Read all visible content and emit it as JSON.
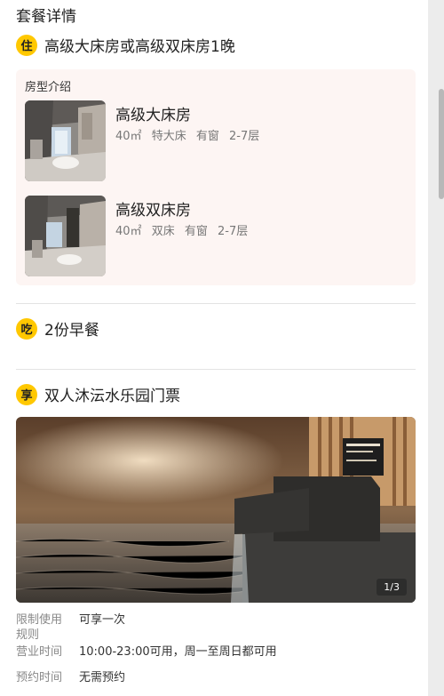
{
  "page": {
    "title": "套餐详情"
  },
  "lodging": {
    "badge": "住",
    "title": "高级大床房或高级双床房1晚",
    "room_type_label": "房型介绍",
    "rooms": [
      {
        "name": "高级大床房",
        "area": "40㎡",
        "bed": "特大床",
        "window": "有窗",
        "floor": "2-7层"
      },
      {
        "name": "高级双床房",
        "area": "40㎡",
        "bed": "双床",
        "window": "有窗",
        "floor": "2-7层"
      }
    ]
  },
  "meal": {
    "badge": "吃",
    "title": "2份早餐"
  },
  "ticket": {
    "badge": "享",
    "title": "双人沐沄水乐园门票",
    "photo_counter": "1/3",
    "info": [
      {
        "label": "限制使用规则",
        "value": "可享一次"
      },
      {
        "label": "营业时间",
        "value": "10:00-23:00可用，周一至周日都可用"
      },
      {
        "label": "预约时间",
        "value": "无需预约"
      }
    ]
  },
  "colors": {
    "badge": "#ffc800",
    "room_box_bg": "#fdf5f3",
    "muted_text": "#777777"
  }
}
